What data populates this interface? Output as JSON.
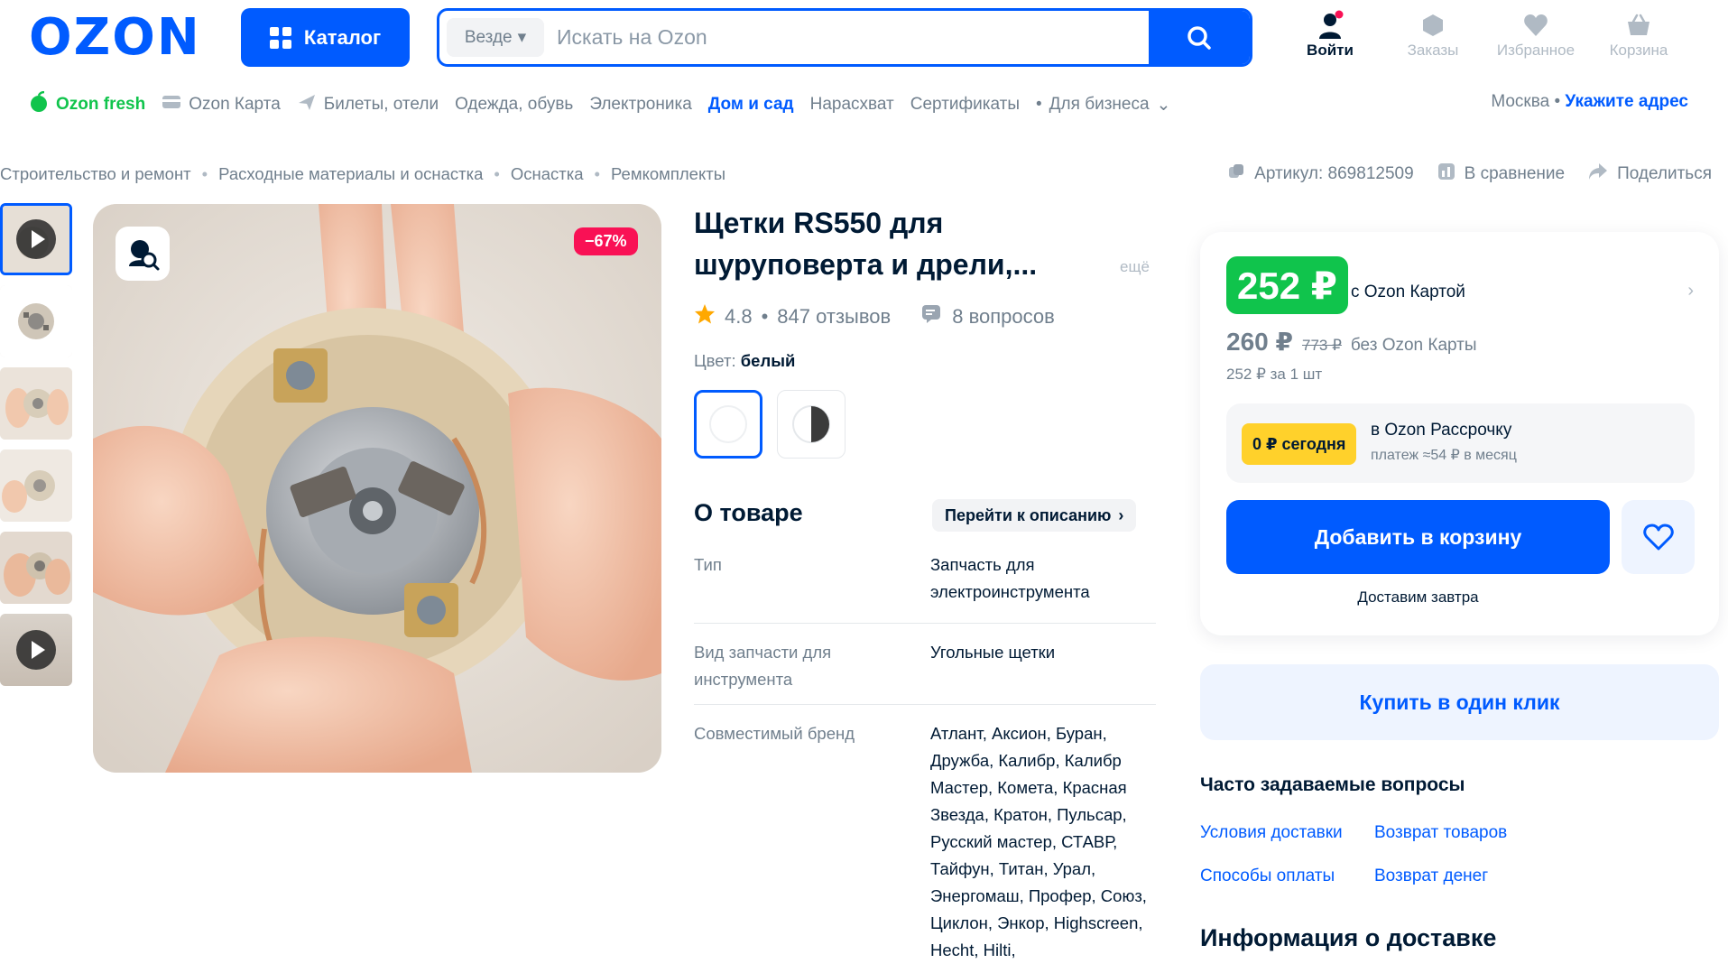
{
  "header": {
    "logo": "OZON",
    "catalog_label": "Каталог",
    "search_scope": "Везде",
    "search_placeholder": "Искать на Ozon",
    "actions": {
      "login": "Войти",
      "orders": "Заказы",
      "favorites": "Избранное",
      "cart": "Корзина"
    }
  },
  "nav": {
    "items": [
      "Ozon fresh",
      "Ozon Карта",
      "Билеты, отели",
      "Одежда, обувь",
      "Электроника",
      "Дом и сад",
      "Нарасхват",
      "Сертификаты",
      "Для бизнеса"
    ],
    "location_city": "Москва",
    "location_link": "Укажите адрес"
  },
  "breadcrumb": [
    "Строительство и ремонт",
    "Расходные материалы и оснастка",
    "Оснастка",
    "Ремкомплекты"
  ],
  "meta": {
    "article": "Артикул: 869812509",
    "compare": "В сравнение",
    "share": "Поделиться"
  },
  "gallery": {
    "discount": "−67%"
  },
  "product": {
    "title": "Щетки RS550 для шуруповерта и дрели,...",
    "more": "ещё",
    "rating": "4.8",
    "reviews": "847 отзывов",
    "questions": "8 вопросов",
    "color_label": "Цвет:",
    "color_value": "белый",
    "about_title": "О товаре",
    "goto_description": "Перейти к описанию",
    "specs": [
      {
        "key": "Тип",
        "value": "Запчасть для электроинструмента"
      },
      {
        "key": "Вид запчасти для инструмента",
        "value": "Угольные щетки"
      },
      {
        "key": "Совместимый бренд",
        "value": "Атлант, Аксион, Буран, Дружба, Калибр, Калибр Мастер, Комета, Красная Звезда, Кратон, Пульсар, Русский мастер, СТАВР, Тайфун, Титан, Урал, Энергомаш, Профер, Союз, Циклон, Энкор, Highscreen, Hecht, Hilti,"
      }
    ]
  },
  "buybox": {
    "card_price": "252 ₽",
    "card_label": "с Ozon Картой",
    "price": "260 ₽",
    "old_price": "773 ₽",
    "no_card_label": "без Ozon Карты",
    "unit_price": "252 ₽ за 1 шт",
    "installment_tag": "0 ₽ сегодня",
    "installment_title": "в Ozon Рассрочку",
    "installment_note": "платеж ≈54 ₽ в месяц",
    "add_to_cart": "Добавить в корзину",
    "delivery_note": "Доставим завтра",
    "one_click": "Купить в один клик"
  },
  "faq": {
    "title": "Часто задаваемые вопросы",
    "links": [
      "Условия доставки",
      "Возврат товаров",
      "Способы оплаты",
      "Возврат денег"
    ]
  },
  "delivery_info_title": "Информация о доставке",
  "colors": {
    "brand": "#005bff",
    "green_price": "#10c44c",
    "discount": "#f91155",
    "installment": "#ffd12b"
  }
}
